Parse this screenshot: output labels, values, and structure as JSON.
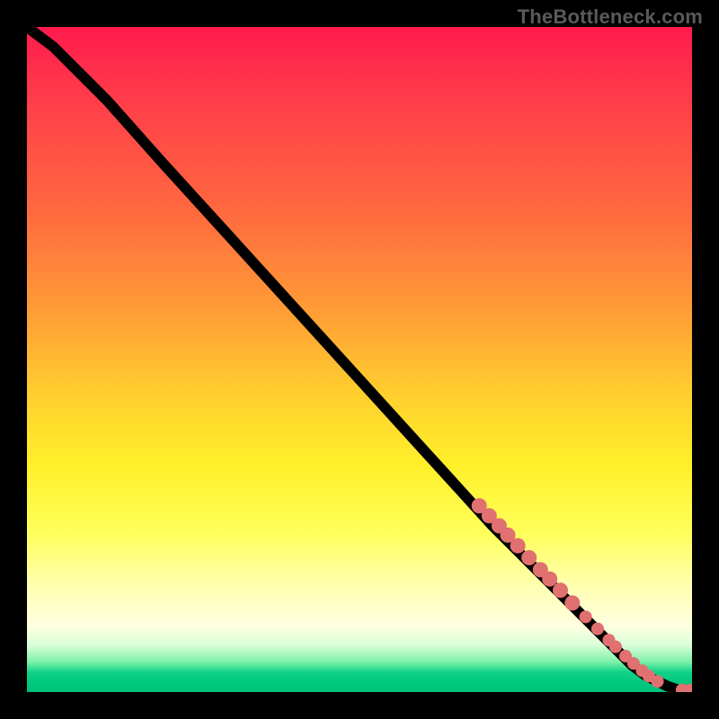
{
  "watermark": "TheBottleneck.com",
  "colors": {
    "background": "#000000",
    "dot": "#e17070",
    "line": "#000000"
  },
  "chart_data": {
    "type": "line",
    "title": "",
    "xlabel": "",
    "ylabel": "",
    "xlim": [
      0,
      100
    ],
    "ylim": [
      0,
      100
    ],
    "grid": false,
    "legend": false,
    "series": [
      {
        "name": "curve",
        "x": [
          0,
          4,
          8,
          12,
          20,
          30,
          40,
          50,
          60,
          70,
          78,
          84,
          88,
          91,
          93,
          95,
          96.5,
          98,
          99,
          100
        ],
        "y": [
          100,
          97,
          93,
          89,
          80,
          69,
          58,
          47,
          36,
          25,
          17,
          11,
          7,
          4,
          2.5,
          1.5,
          0.8,
          0.3,
          0.3,
          0.3
        ]
      }
    ],
    "points": [
      {
        "x": 68,
        "y": 28
      },
      {
        "x": 69.5,
        "y": 26.5
      },
      {
        "x": 71,
        "y": 25
      },
      {
        "x": 72.3,
        "y": 23.6
      },
      {
        "x": 73.8,
        "y": 22
      },
      {
        "x": 75.5,
        "y": 20.2
      },
      {
        "x": 77.2,
        "y": 18.4
      },
      {
        "x": 78.6,
        "y": 17
      },
      {
        "x": 80.2,
        "y": 15.3
      },
      {
        "x": 82,
        "y": 13.4
      },
      {
        "x": 84,
        "y": 11.3
      },
      {
        "x": 85.8,
        "y": 9.5
      },
      {
        "x": 87.5,
        "y": 7.8
      },
      {
        "x": 88.5,
        "y": 6.8
      },
      {
        "x": 90,
        "y": 5.4
      },
      {
        "x": 91.2,
        "y": 4.3
      },
      {
        "x": 92.5,
        "y": 3.2
      },
      {
        "x": 93.5,
        "y": 2.4
      },
      {
        "x": 94.8,
        "y": 1.6
      },
      {
        "x": 98.5,
        "y": 0.3
      },
      {
        "x": 99.7,
        "y": 0.3
      }
    ]
  }
}
